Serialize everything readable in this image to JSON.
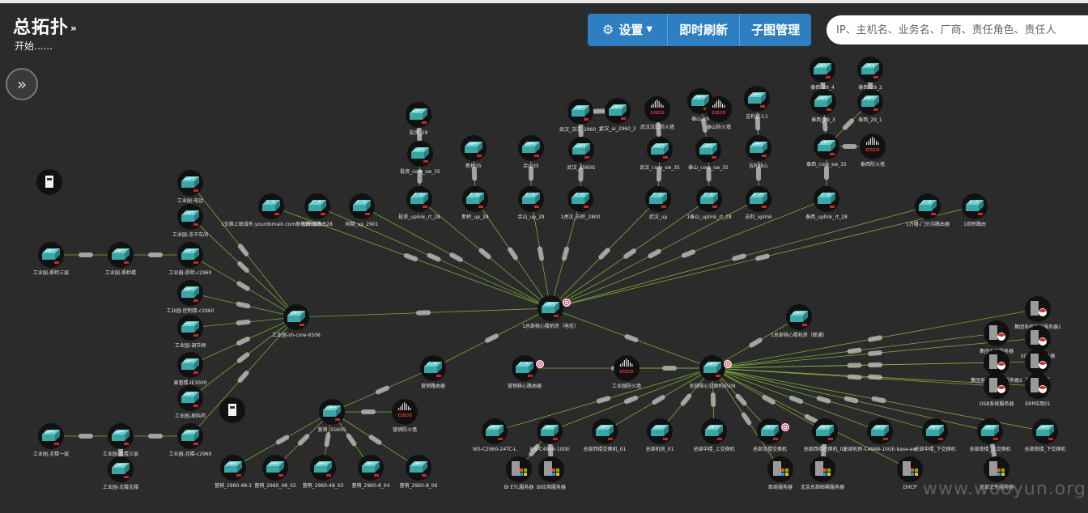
{
  "header": {
    "title": "总拓扑",
    "title_caret": "»",
    "subtitle": "开始......",
    "expand_icon": "»"
  },
  "toolbar": {
    "settings_label": "设置",
    "refresh_label": "即时刷新",
    "subgraph_label": "子图管理"
  },
  "search": {
    "placeholder": "IP、主机名、业务名、厂商、责任角色、责任人"
  },
  "colors": {
    "background": "#2b2b2b",
    "toolbar_blue": "#2d7fc1",
    "switch_teal": "#3aa6a6",
    "node_ring": "#111111",
    "link_green": "#8fbf3a"
  },
  "watermark": "www.wooyun.org",
  "nodes": [
    {
      "id": "core",
      "type": "switch",
      "label": "1总部核心楼机房（电信）"
    },
    {
      "id": "core2",
      "type": "switch",
      "label": "总部核心交换机6509"
    },
    {
      "id": "sh_core",
      "type": "switch",
      "label": "工业园-sh-core-6506"
    },
    {
      "id": "core3",
      "type": "switch",
      "label": "1总部核心楼机房（联通）"
    },
    {
      "id": "cisco_mid",
      "type": "cisco",
      "label": "工业园防火墙"
    },
    {
      "id": "edu1",
      "type": "router",
      "label": "营销核心路由器"
    },
    {
      "id": "edu2",
      "type": "router",
      "label": "营销路由器"
    },
    {
      "id": "vpn",
      "type": "router",
      "label": "1交换上联城市.yourdomain.com联机路由28"
    },
    {
      "id": "r2",
      "type": "router",
      "label": "旧环境路由28"
    },
    {
      "id": "r3",
      "type": "router",
      "label": "同期_up_2901"
    },
    {
      "id": "r4",
      "type": "router",
      "label": "投资_uplink_rt_28"
    },
    {
      "id": "r5",
      "type": "router",
      "label": "新桥_up_29"
    },
    {
      "id": "r6",
      "type": "router",
      "label": "余山_up_29"
    },
    {
      "id": "r7",
      "type": "router",
      "label": "1虎汉_石岭_2800"
    },
    {
      "id": "r8",
      "type": "router",
      "label": "武汉_up"
    },
    {
      "id": "r9",
      "type": "router",
      "label": "1泰山_uplink_rt_28"
    },
    {
      "id": "r10",
      "type": "router",
      "label": "吉利_uplink"
    },
    {
      "id": "r11",
      "type": "router",
      "label": "泰西_uplink_rt_28"
    },
    {
      "id": "r12",
      "type": "router",
      "label": "1万隆-门头沟路由器"
    },
    {
      "id": "r13",
      "type": "router",
      "label": "1双桥路由"
    },
    {
      "id": "s_a1",
      "type": "switch",
      "label": "投资_29"
    },
    {
      "id": "s_a2",
      "type": "switch",
      "label": "投资_core_sw_35"
    },
    {
      "id": "s_b1",
      "type": "switch",
      "label": "新桥35"
    },
    {
      "id": "s_c1",
      "type": "switch",
      "label": "余山35"
    },
    {
      "id": "s_d1",
      "type": "switch",
      "label": "武汉_3560G"
    },
    {
      "id": "s_d2",
      "type": "switch",
      "label": "武汉_汉江_2960_1"
    },
    {
      "id": "s_d3",
      "type": "switch",
      "label": "武汉_ai_2960_2"
    },
    {
      "id": "cisco_wh",
      "type": "cisco",
      "label": "武汉汉口防火墙"
    },
    {
      "id": "s_e1",
      "type": "switch",
      "label": "武汉_core_sw_35"
    },
    {
      "id": "s_f1",
      "type": "switch",
      "label": "泰山_core_sw_35"
    },
    {
      "id": "s_f2",
      "type": "switch",
      "label": "泰山-29"
    },
    {
      "id": "cisco_ts",
      "type": "cisco",
      "label": "泰山防火墙"
    },
    {
      "id": "s_g1",
      "type": "switch",
      "label": "吉利核心"
    },
    {
      "id": "s_g2",
      "type": "switch",
      "label": "吉利接入1"
    },
    {
      "id": "s_h1",
      "type": "switch",
      "label": "泰西_core_sw_35"
    },
    {
      "id": "s_h2",
      "type": "switch",
      "label": "泰西_29_4"
    },
    {
      "id": "s_h3",
      "type": "switch",
      "label": "泰西_29_2"
    },
    {
      "id": "s_h4",
      "type": "switch",
      "label": "泰西_29_3"
    },
    {
      "id": "s_h5",
      "type": "switch",
      "label": "泰西_29_1"
    },
    {
      "id": "cisco_tx",
      "type": "cisco",
      "label": "泰西防火墙"
    },
    {
      "id": "w1",
      "type": "switch",
      "label": "工业园-电话"
    },
    {
      "id": "w2",
      "type": "switch",
      "label": "工业园-冻干车间"
    },
    {
      "id": "w3",
      "type": "switch",
      "label": "工业园-质检-c2960"
    },
    {
      "id": "w4",
      "type": "switch",
      "label": "工业园-质检楼"
    },
    {
      "id": "w5",
      "type": "switch",
      "label": "工业园-质检三层"
    },
    {
      "id": "w6",
      "type": "switch",
      "label": "工业园-控制楼-c2960"
    },
    {
      "id": "w7",
      "type": "switch",
      "label": "工业园-调节阀"
    },
    {
      "id": "w8",
      "type": "switch",
      "label": "高管楼-IE3000"
    },
    {
      "id": "w9",
      "type": "switch",
      "label": "工业园-原料药"
    },
    {
      "id": "w10",
      "type": "switch",
      "label": "工业园-北楼-c2960"
    },
    {
      "id": "w11",
      "type": "switch",
      "label": "工业园-北楼三层"
    },
    {
      "id": "w12",
      "type": "switch",
      "label": "工业园-北楼一层"
    },
    {
      "id": "w13",
      "type": "switch",
      "label": "工业园-北楼北楼"
    },
    {
      "id": "srv_a",
      "type": "server",
      "label": ""
    },
    {
      "id": "srv_b",
      "type": "server",
      "label": ""
    },
    {
      "id": "m1",
      "type": "switch",
      "label": "营销_3560G"
    },
    {
      "id": "cisco_m",
      "type": "cisco",
      "label": "营销防火墙"
    },
    {
      "id": "m2",
      "type": "switch",
      "label": "营销_2960-48-1"
    },
    {
      "id": "m3",
      "type": "switch",
      "label": "营销_2960_48_02"
    },
    {
      "id": "m4",
      "type": "switch",
      "label": "营销_2960-48_03"
    },
    {
      "id": "m5",
      "type": "switch",
      "label": "营销_2960-8_04"
    },
    {
      "id": "m6",
      "type": "switch",
      "label": "营销_2960-8_06"
    },
    {
      "id": "b1",
      "type": "switch",
      "label": "WS-C2960-24TC-L"
    },
    {
      "id": "b2",
      "type": "switch",
      "label": "WS-C4948-10GE"
    },
    {
      "id": "b3",
      "type": "switch",
      "label": "总部西楼交换机_01"
    },
    {
      "id": "b4",
      "type": "switch",
      "label": "总部机房_01"
    },
    {
      "id": "b5",
      "type": "switch",
      "label": "总部中楼_上交换机"
    },
    {
      "id": "b6",
      "type": "switch",
      "label": "总部北楼交换机"
    },
    {
      "id": "b7",
      "type": "switch",
      "label": "总部西楼交换机_02"
    },
    {
      "id": "b8",
      "type": "switch",
      "label": "总部机房-C4948-10GE-base-ew"
    },
    {
      "id": "b9",
      "type": "switch",
      "label": "总部中楼_下交换机"
    },
    {
      "id": "b10",
      "type": "switch",
      "label": "总部南楼_上交换机"
    },
    {
      "id": "b11",
      "type": "switch",
      "label": "总部南楼_下交换机"
    },
    {
      "id": "pc1",
      "type": "windows",
      "label": "BI ETL服务器"
    },
    {
      "id": "pc2",
      "type": "windows",
      "label": "BI应用服务器"
    },
    {
      "id": "pc3",
      "type": "windows",
      "label": "致商服务器"
    },
    {
      "id": "pc4",
      "type": "windows",
      "label": "北京总部邮箱服务器"
    },
    {
      "id": "pc5",
      "type": "windows",
      "label": "DHCP"
    },
    {
      "id": "pc6",
      "type": "windows",
      "label": "总部文件服务器"
    },
    {
      "id": "rs1",
      "type": "redhat",
      "label": "集团系统备份服务器1"
    },
    {
      "id": "rs2",
      "type": "redhat",
      "label": "SOA系统服务器"
    },
    {
      "id": "rs3",
      "type": "redhat",
      "label": "集团业务服务器"
    },
    {
      "id": "rs4",
      "type": "redhat",
      "label": "集团系统数据库服务器2"
    },
    {
      "id": "rs5",
      "type": "redhat",
      "label": "ERP数据库"
    },
    {
      "id": "rs6",
      "type": "redhat",
      "label": "OSB系统服务器"
    },
    {
      "id": "rs7",
      "type": "redhat",
      "label": "ERP应用01"
    }
  ]
}
